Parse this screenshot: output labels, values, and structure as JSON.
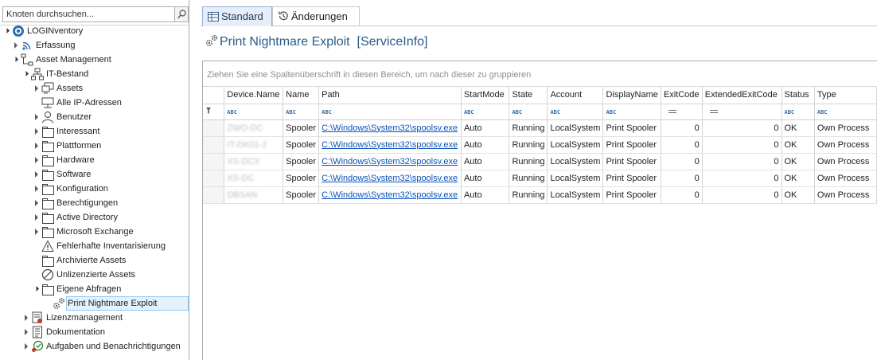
{
  "search": {
    "placeholder": "Knoten durchsuchen..."
  },
  "tree": {
    "root": "LOGINventory",
    "items": [
      {
        "label": "Erfassung"
      },
      {
        "label": "Asset Management"
      },
      {
        "label": "IT-Bestand"
      },
      {
        "label": "Assets"
      },
      {
        "label": "Alle IP-Adressen"
      },
      {
        "label": "Benutzer"
      },
      {
        "label": "Interessant"
      },
      {
        "label": "Plattformen"
      },
      {
        "label": "Hardware"
      },
      {
        "label": "Software"
      },
      {
        "label": "Konfiguration"
      },
      {
        "label": "Berechtigungen"
      },
      {
        "label": "Active Directory"
      },
      {
        "label": "Microsoft Exchange"
      },
      {
        "label": "Fehlerhafte Inventarisierung"
      },
      {
        "label": "Archivierte Assets"
      },
      {
        "label": "Unlizenzierte Assets"
      },
      {
        "label": "Eigene Abfragen"
      },
      {
        "label": "Print Nightmare Exploit"
      },
      {
        "label": "Lizenzmanagement"
      },
      {
        "label": "Dokumentation"
      },
      {
        "label": "Aufgaben und Benachrichtigungen"
      }
    ]
  },
  "tabs": [
    {
      "label": "Standard"
    },
    {
      "label": "Änderungen"
    }
  ],
  "view": {
    "title": "Print Nightmare Exploit  [ServiceInfo]"
  },
  "grid": {
    "group_hint": "Ziehen Sie eine Spaltenüberschrift in diesen Bereich, um nach dieser zu gruppieren",
    "filter_text_symbol": "ABC",
    "columns": [
      "Device.Name",
      "Name",
      "Path",
      "StartMode",
      "State",
      "Account",
      "DisplayName",
      "ExitCode",
      "ExtendedExitCode",
      "Status",
      "Type"
    ],
    "rows": [
      {
        "device": "ZWO-DC",
        "name": "Spooler",
        "path": "C:\\Windows\\System32\\spoolsv.exe",
        "startmode": "Auto",
        "state": "Running",
        "account": "LocalSystem",
        "displayname": "Print Spooler",
        "exitcode": "0",
        "extexitcode": "0",
        "status": "OK",
        "type": "Own Process"
      },
      {
        "device": "IT-DK01-2",
        "name": "Spooler",
        "path": "C:\\Windows\\System32\\spoolsv.exe",
        "startmode": "Auto",
        "state": "Running",
        "account": "LocalSystem",
        "displayname": "Print Spooler",
        "exitcode": "0",
        "extexitcode": "0",
        "status": "OK",
        "type": "Own Process"
      },
      {
        "device": "XS-DCX",
        "name": "Spooler",
        "path": "C:\\Windows\\System32\\spoolsv.exe",
        "startmode": "Auto",
        "state": "Running",
        "account": "LocalSystem",
        "displayname": "Print Spooler",
        "exitcode": "0",
        "extexitcode": "0",
        "status": "OK",
        "type": "Own Process"
      },
      {
        "device": "XS-DC",
        "name": "Spooler",
        "path": "C:\\Windows\\System32\\spoolsv.exe",
        "startmode": "Auto",
        "state": "Running",
        "account": "LocalSystem",
        "displayname": "Print Spooler",
        "exitcode": "0",
        "extexitcode": "0",
        "status": "OK",
        "type": "Own Process"
      },
      {
        "device": "DBSAN",
        "name": "Spooler",
        "path": "C:\\Windows\\System32\\spoolsv.exe",
        "startmode": "Auto",
        "state": "Running",
        "account": "LocalSystem",
        "displayname": "Print Spooler",
        "exitcode": "0",
        "extexitcode": "0",
        "status": "OK",
        "type": "Own Process"
      }
    ]
  },
  "colors": {
    "accent": "#2a5b8a",
    "link": "#0b52b7",
    "selection": "#e5f1fb"
  }
}
